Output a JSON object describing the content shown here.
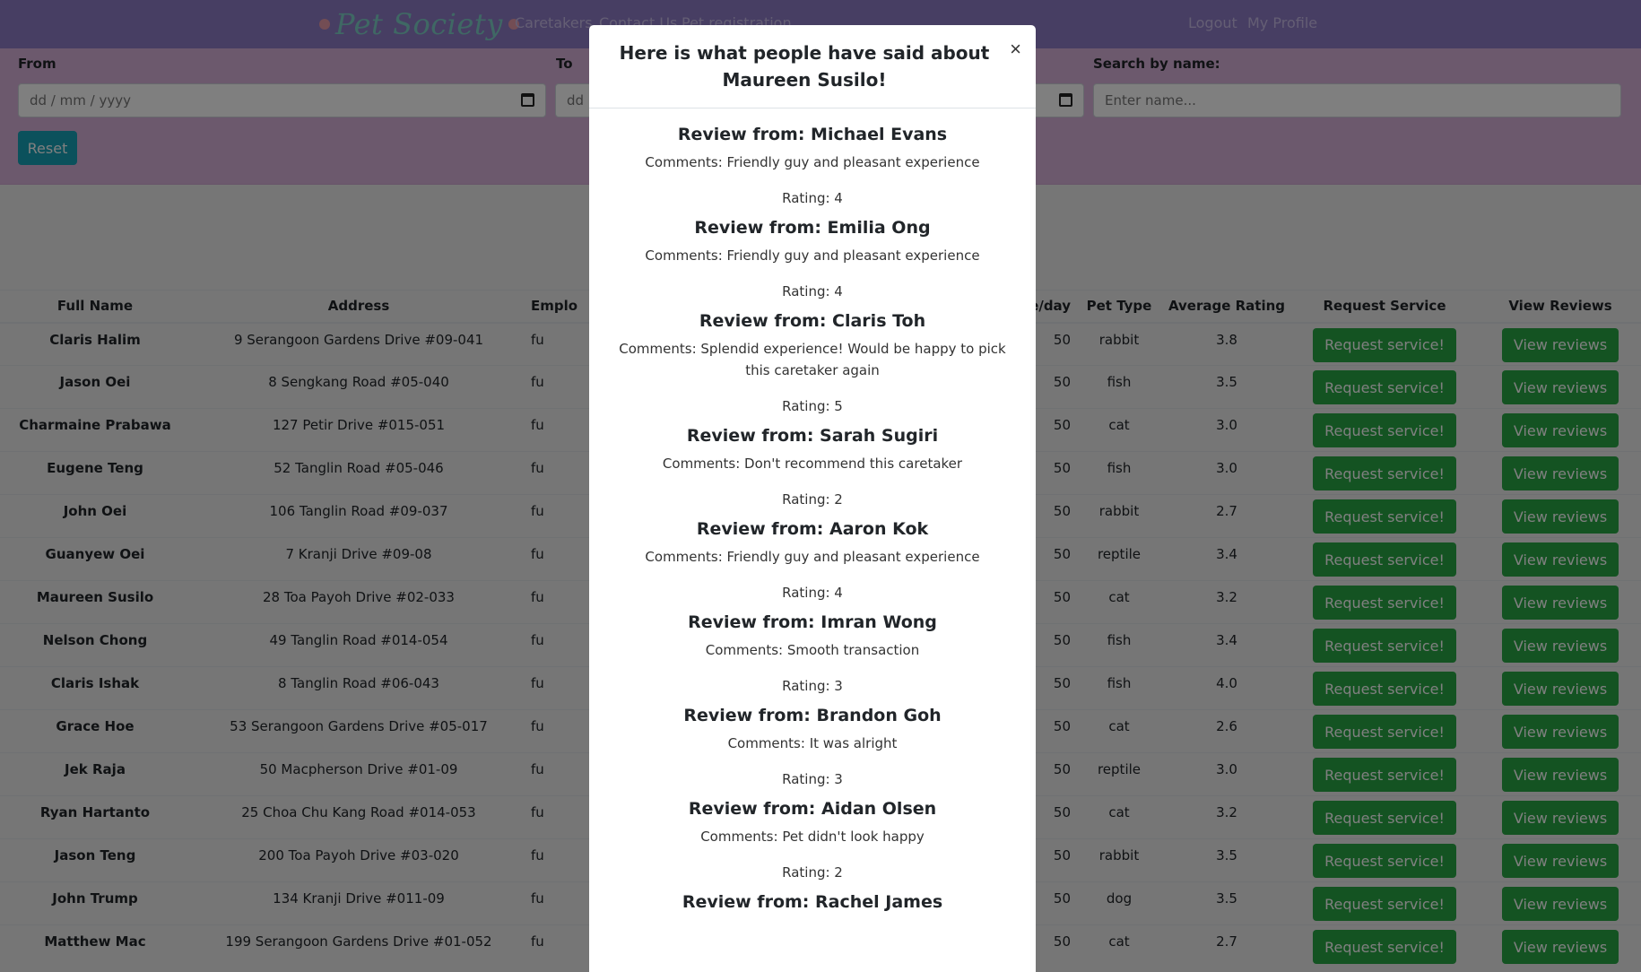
{
  "nav": {
    "brand": "Pet Society",
    "links": [
      "Caretakers",
      "Contact Us",
      "Pet registration"
    ],
    "right_links": [
      "Logout",
      "My Profile"
    ]
  },
  "filters": {
    "from_label": "From",
    "to_label": "To",
    "date_placeholder": "dd / mm / yyyy",
    "to_partial": "dd",
    "search_label": "Search by name:",
    "search_placeholder": "Enter name...",
    "reset_label": "Reset"
  },
  "table": {
    "headers": [
      "Full Name",
      "Address",
      "Emplo",
      "e/day",
      "Pet Type",
      "Average Rating",
      "Request Service",
      "View Reviews"
    ],
    "request_label": "Request service!",
    "view_label": "View reviews",
    "rows": [
      {
        "name": "Claris Halim",
        "address": "9 Serangoon Gardens Drive #09-041",
        "emp": "fu",
        "rate": "50",
        "pet": "rabbit",
        "rating": "3.8"
      },
      {
        "name": "Jason Oei",
        "address": "8 Sengkang Road #05-040",
        "emp": "fu",
        "rate": "50",
        "pet": "fish",
        "rating": "3.5"
      },
      {
        "name": "Charmaine Prabawa",
        "address": "127 Petir Drive #015-051",
        "emp": "fu",
        "rate": "50",
        "pet": "cat",
        "rating": "3.0"
      },
      {
        "name": "Eugene Teng",
        "address": "52 Tanglin Road #05-046",
        "emp": "fu",
        "rate": "50",
        "pet": "fish",
        "rating": "3.0"
      },
      {
        "name": "John Oei",
        "address": "106 Tanglin Road #09-037",
        "emp": "fu",
        "rate": "50",
        "pet": "rabbit",
        "rating": "2.7"
      },
      {
        "name": "Guanyew Oei",
        "address": "7 Kranji Drive #09-08",
        "emp": "fu",
        "rate": "50",
        "pet": "reptile",
        "rating": "3.4"
      },
      {
        "name": "Maureen Susilo",
        "address": "28 Toa Payoh Drive #02-033",
        "emp": "fu",
        "rate": "50",
        "pet": "cat",
        "rating": "3.2"
      },
      {
        "name": "Nelson Chong",
        "address": "49 Tanglin Road #014-054",
        "emp": "fu",
        "rate": "50",
        "pet": "fish",
        "rating": "3.4"
      },
      {
        "name": "Claris Ishak",
        "address": "8 Tanglin Road #06-043",
        "emp": "fu",
        "rate": "50",
        "pet": "fish",
        "rating": "4.0"
      },
      {
        "name": "Grace Hoe",
        "address": "53 Serangoon Gardens Drive #05-017",
        "emp": "fu",
        "rate": "50",
        "pet": "cat",
        "rating": "2.6"
      },
      {
        "name": "Jek Raja",
        "address": "50 Macpherson Drive #01-09",
        "emp": "fu",
        "rate": "50",
        "pet": "reptile",
        "rating": "3.0"
      },
      {
        "name": "Ryan Hartanto",
        "address": "25 Choa Chu Kang Road #014-053",
        "emp": "fu",
        "rate": "50",
        "pet": "cat",
        "rating": "3.2"
      },
      {
        "name": "Jason Teng",
        "address": "200 Toa Payoh Drive #03-020",
        "emp": "fu",
        "rate": "50",
        "pet": "rabbit",
        "rating": "3.5"
      },
      {
        "name": "John Trump",
        "address": "134 Kranji Drive #011-09",
        "emp": "fu",
        "rate": "50",
        "pet": "dog",
        "rating": "3.5"
      },
      {
        "name": "Matthew Mac",
        "address": "199 Serangoon Gardens Drive #01-052",
        "emp": "fu",
        "rate": "50",
        "pet": "cat",
        "rating": "2.7"
      }
    ]
  },
  "modal": {
    "title": "Here is what people have said about Maureen Susilo!",
    "close": "×",
    "reviews": [
      {
        "from": "Review from: Michael Evans",
        "comments": "Comments: Friendly guy and pleasant experience",
        "rating": "Rating: 4"
      },
      {
        "from": "Review from: Emilia Ong",
        "comments": "Comments: Friendly guy and pleasant experience",
        "rating": "Rating: 4"
      },
      {
        "from": "Review from: Claris Toh",
        "comments": "Comments: Splendid experience! Would be happy to pick this caretaker again",
        "rating": "Rating: 5"
      },
      {
        "from": "Review from: Sarah Sugiri",
        "comments": "Comments: Don't recommend this caretaker",
        "rating": "Rating: 2"
      },
      {
        "from": "Review from: Aaron Kok",
        "comments": "Comments: Friendly guy and pleasant experience",
        "rating": "Rating: 4"
      },
      {
        "from": "Review from: Imran Wong",
        "comments": "Comments: Smooth transaction",
        "rating": "Rating: 3"
      },
      {
        "from": "Review from: Brandon Goh",
        "comments": "Comments: It was alright",
        "rating": "Rating: 3"
      },
      {
        "from": "Review from: Aidan Olsen",
        "comments": "Comments: Pet didn't look happy",
        "rating": "Rating: 2"
      },
      {
        "from": "Review from: Rachel James",
        "comments": "",
        "rating": ""
      }
    ]
  }
}
